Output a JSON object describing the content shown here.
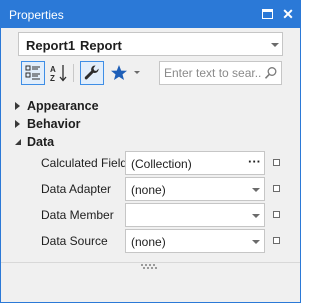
{
  "window": {
    "title": "Properties",
    "restore_icon": "restore-icon",
    "close_icon": "close-icon",
    "close_glyph": "✕"
  },
  "object_selector": {
    "name": "Report1",
    "type": "Report"
  },
  "toolbar": {
    "categorized_icon": "categorized-icon",
    "alphabetical_icon": "sort-alphabetical-icon",
    "properties_icon": "wrench-icon",
    "events_icon": "star-icon",
    "search_placeholder": "Enter text to sear...",
    "search_value": "",
    "search_icon": "search-icon"
  },
  "categories": [
    {
      "label": "Appearance",
      "expanded": false
    },
    {
      "label": "Behavior",
      "expanded": false
    },
    {
      "label": "Data",
      "expanded": true
    }
  ],
  "properties": [
    {
      "name": "Calculated Fields",
      "value": "(Collection)",
      "editor": "ellipsis",
      "ellipsis_label": "···"
    },
    {
      "name": "Data Adapter",
      "value": "(none)",
      "editor": "dropdown"
    },
    {
      "name": "Data Member",
      "value": "",
      "editor": "dropdown"
    },
    {
      "name": "Data Source",
      "value": "(none)",
      "editor": "dropdown"
    }
  ],
  "colors": {
    "accent": "#2b79d7",
    "panel_bg": "#f0f0f0",
    "editor_border": "#c6c6c6",
    "events_star": "#1e5fb8"
  }
}
